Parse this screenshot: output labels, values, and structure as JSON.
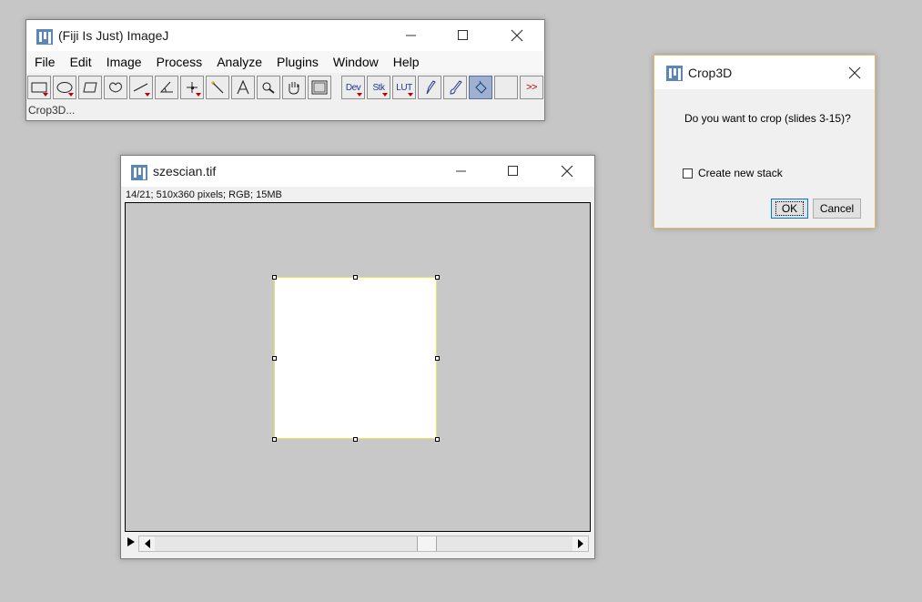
{
  "main_window": {
    "title": "(Fiji Is Just) ImageJ",
    "menus": [
      "File",
      "Edit",
      "Image",
      "Process",
      "Analyze",
      "Plugins",
      "Window",
      "Help"
    ],
    "tools": {
      "dev": "Dev",
      "stk": "Stk",
      "lut": "LUT",
      "more": ">>"
    },
    "status": "Crop3D..."
  },
  "image_window": {
    "title": "szescian.tif",
    "info": "14/21; 510x360 pixels; RGB; 15MB",
    "scroll_fraction": 0.66
  },
  "dialog": {
    "title": "Crop3D",
    "question": "Do you want to crop (slides 3-15)?",
    "checkbox_label": "Create new stack",
    "checkbox_checked": false,
    "ok_label": "OK",
    "cancel_label": "Cancel"
  },
  "colors": {
    "desktop": "#c6c6c6",
    "active_tool": "#9fb1d1",
    "roi_outline": "#e5e55c",
    "dialog_border": "#e4b772",
    "dropdown_arrow": "#c00000"
  }
}
